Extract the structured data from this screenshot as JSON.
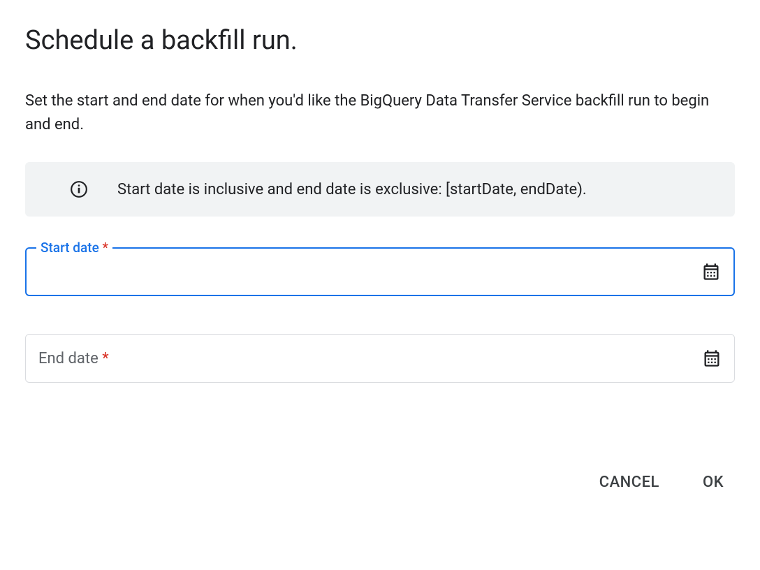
{
  "dialog": {
    "title": "Schedule a backfill run.",
    "description": "Set the start and end date for when you'd like the BigQuery Data Transfer Service backfill run to begin and end.",
    "info_text": "Start date is inclusive and end date is exclusive: [startDate, endDate)."
  },
  "fields": {
    "start_date": {
      "label": "Start date",
      "value": "",
      "required_marker": "*"
    },
    "end_date": {
      "label": "End date",
      "value": "",
      "required_marker": "*"
    }
  },
  "actions": {
    "cancel": "CANCEL",
    "ok": "OK"
  }
}
